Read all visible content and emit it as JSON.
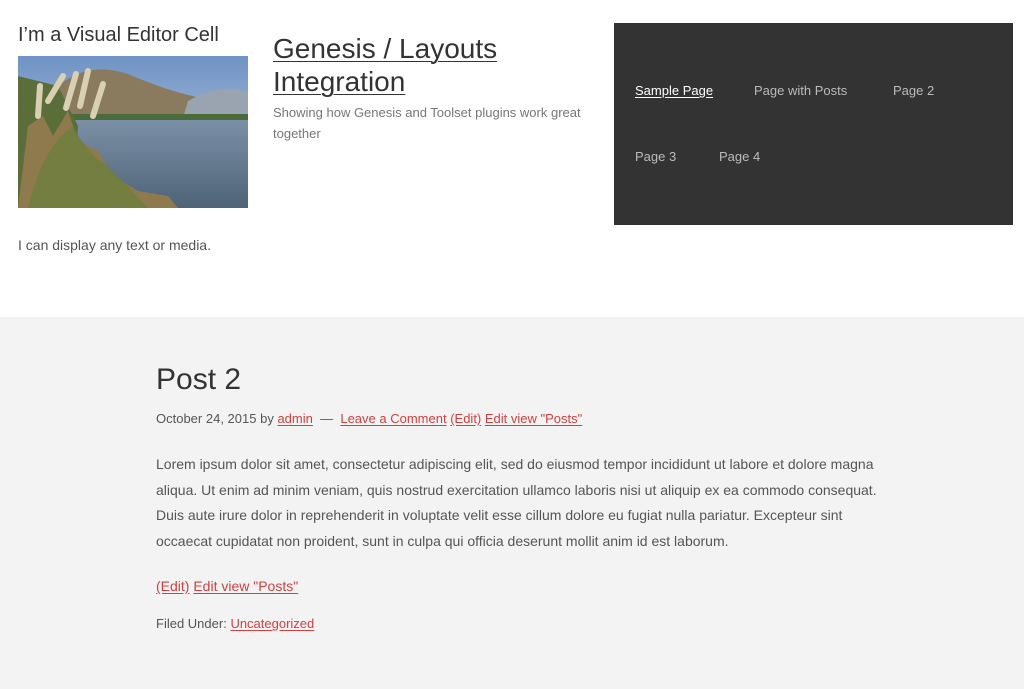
{
  "visual_cell": {
    "title": "I’m a Visual Editor Cell",
    "text": "I can display any text or media."
  },
  "site": {
    "title": "Genesis / Layouts Integration",
    "description": "Showing how Genesis and Toolset plugins work great together"
  },
  "nav": {
    "items": [
      {
        "label": "Sample Page",
        "current": true
      },
      {
        "label": "Page with Posts",
        "current": false
      },
      {
        "label": "Page 2",
        "current": false
      },
      {
        "label": "Page 3",
        "current": false
      },
      {
        "label": "Page 4",
        "current": false
      }
    ]
  },
  "post": {
    "title": "Post 2",
    "date": "October 24, 2015",
    "by": "by",
    "author": "admin",
    "separator": "—",
    "comment_link": "Leave a Comment",
    "edit_link": "(Edit)",
    "edit_view_link": "Edit view \"Posts\"",
    "content": "Lorem ipsum dolor sit amet, consectetur adipiscing elit, sed do eiusmod tempor incididunt ut labore et dolore magna aliqua. Ut enim ad minim veniam, quis nostrud exercitation ullamco laboris nisi ut aliquip ex ea commodo consequat. Duis aute irure dolor in reprehenderit in voluptate velit esse cillum dolore eu fugiat nulla pariatur. Excepteur sint occaecat cupidatat non proident, sunt in culpa qui officia deserunt mollit anim id est laborum.",
    "bottom_edit_link": "(Edit)",
    "bottom_edit_view_link": "Edit view \"Posts\"",
    "filed_under": "Filed Under:",
    "category": "Uncategorized"
  },
  "colors": {
    "link_red": "#d04040",
    "nav_background": "#333333",
    "content_background": "#f3f3f3"
  }
}
